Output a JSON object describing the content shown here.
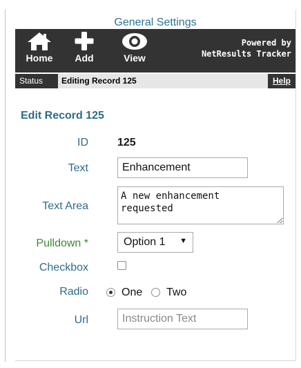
{
  "app_title": "General Settings",
  "toolbar": {
    "home_label": "Home",
    "add_label": "Add",
    "view_label": "View",
    "brand_line1": "Powered by",
    "brand_line2": "NetResults Tracker",
    "home_icon": "home-icon",
    "add_icon": "plus-icon",
    "view_icon": "eye-icon"
  },
  "status_bar": {
    "tag": "Status",
    "text": "Editing Record 125",
    "help": "Help"
  },
  "form": {
    "title": "Edit Record 125",
    "id_label": "ID",
    "id_value": "125",
    "text_label": "Text",
    "text_value": "Enhancement",
    "textarea_label": "Text Area",
    "textarea_value": "A new enhancement\nrequested",
    "pulldown_label": "Pulldown *",
    "pulldown_value": "Option 1",
    "checkbox_label": "Checkbox",
    "checkbox_checked": false,
    "radio_label": "Radio",
    "radio_options": [
      "One",
      "Two"
    ],
    "radio_selected": "One",
    "url_label": "Url",
    "url_placeholder": "Instruction Text"
  },
  "colors": {
    "accent": "#2e6b8a",
    "required": "#3a8a2e",
    "toolbar_bg": "#333333",
    "status_bg": "#e6e6e6"
  }
}
